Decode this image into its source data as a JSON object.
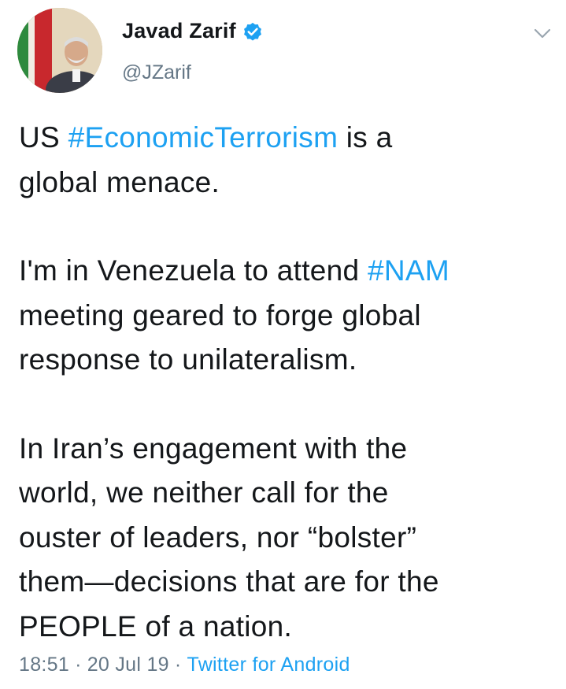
{
  "author": {
    "display_name": "Javad Zarif",
    "handle": "@JZarif",
    "verified": true
  },
  "icons": {
    "verified": "verified-badge-icon",
    "caret": "chevron-down-icon"
  },
  "colors": {
    "link": "#1da1f2",
    "text": "#14171a",
    "muted": "#657786"
  },
  "tweet": {
    "p1": {
      "pre": "US ",
      "hashtag": "#EconomicTerrorism",
      "line1_post": " is a",
      "line2": "global menace."
    },
    "p2": {
      "pre": "I'm in Venezuela to attend ",
      "hashtag": "#NAM",
      "line2": "meeting geared to forge global",
      "line3": "response to unilateralism."
    },
    "p3": {
      "line1": "In Iran’s engagement with the",
      "line2": "world, we neither call for the",
      "line3": "ouster of leaders, nor “bolster”",
      "line4": "them—decisions that are for the",
      "line5": "PEOPLE of a nation."
    }
  },
  "meta": {
    "time": "18:51",
    "date": "20 Jul 19",
    "separator": "·",
    "source": "Twitter for Android"
  }
}
